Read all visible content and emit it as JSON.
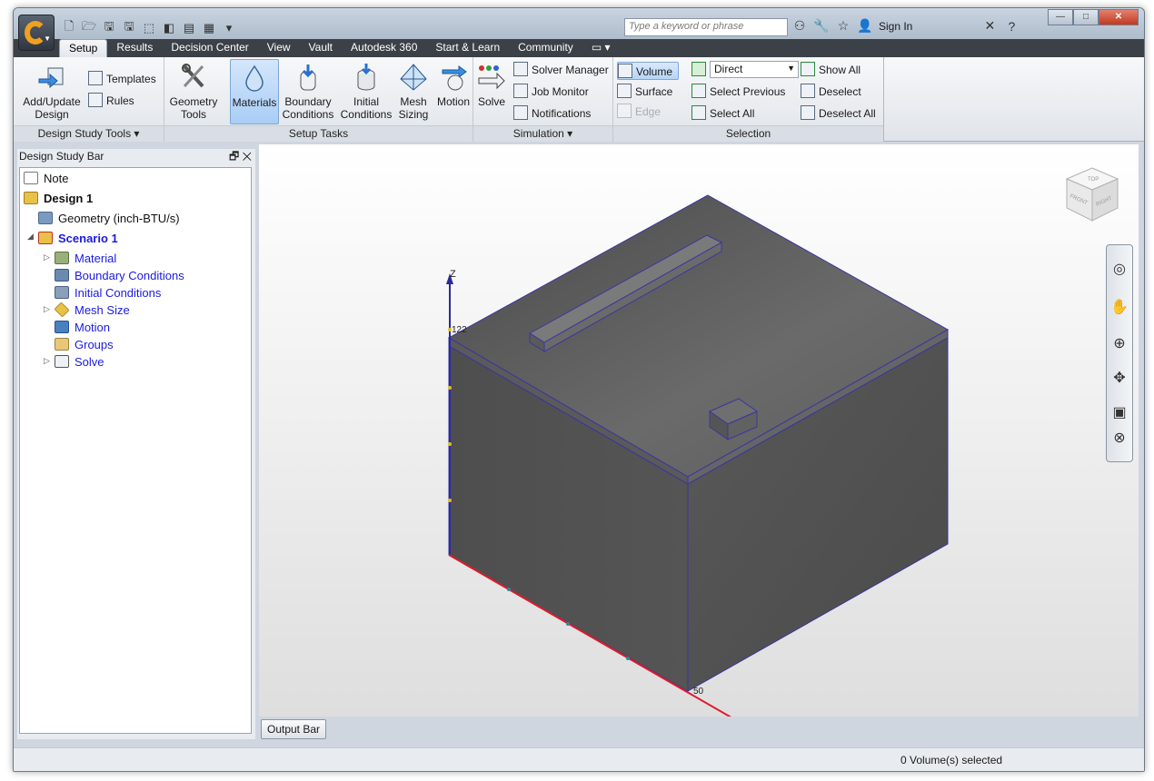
{
  "titlebar": {
    "search_placeholder": "Type a keyword or phrase",
    "sign_in": "Sign In"
  },
  "tabs": [
    "Setup",
    "Results",
    "Decision Center",
    "View",
    "Vault",
    "Autodesk 360",
    "Start & Learn",
    "Community"
  ],
  "ribbon": {
    "design_tools": {
      "add_update": [
        "Add/Update",
        "Design"
      ],
      "templates": "Templates",
      "rules": "Rules",
      "label": "Design Study Tools ▾"
    },
    "setup_tasks": {
      "geometry": [
        "Geometry",
        "Tools"
      ],
      "materials": "Materials",
      "boundary": [
        "Boundary",
        "Conditions"
      ],
      "initial": [
        "Initial",
        "Conditions"
      ],
      "mesh": [
        "Mesh",
        "Sizing"
      ],
      "motion": "Motion",
      "label": "Setup Tasks"
    },
    "simulation": {
      "solve": "Solve",
      "solver_manager": "Solver Manager",
      "job_monitor": "Job Monitor",
      "notifications": "Notifications",
      "label": "Simulation ▾"
    },
    "selection": {
      "volume": "Volume",
      "surface": "Surface",
      "edge": "Edge",
      "direct": "Direct",
      "select_previous": "Select Previous",
      "select_all": "Select All",
      "show_all": "Show All",
      "deselect": "Deselect",
      "deselect_all": "Deselect All",
      "label": "Selection"
    }
  },
  "left_panel": {
    "title": "Design Study Bar",
    "tree": {
      "note": "Note",
      "design": "Design 1",
      "geometry": "Geometry (inch-BTU/s)",
      "scenario": "Scenario 1",
      "material": "Material",
      "boundary": "Boundary Conditions",
      "initial": "Initial Conditions",
      "mesh": "Mesh Size",
      "motion": "Motion",
      "groups": "Groups",
      "solve": "Solve"
    }
  },
  "viewport": {
    "axis_z": "Z",
    "axis_z_value": "122",
    "axis_x_value": "50",
    "viewcube": {
      "top": "TOP",
      "front": "FRONT",
      "right": "RIGHT"
    },
    "colors": {
      "model_face": "#4a4a4a",
      "edges": "#3a35a0",
      "z_axis": "#2a2a9c",
      "x_axis": "#e01a2a"
    }
  },
  "output_bar": "Output Bar",
  "status": "0 Volume(s) selected"
}
